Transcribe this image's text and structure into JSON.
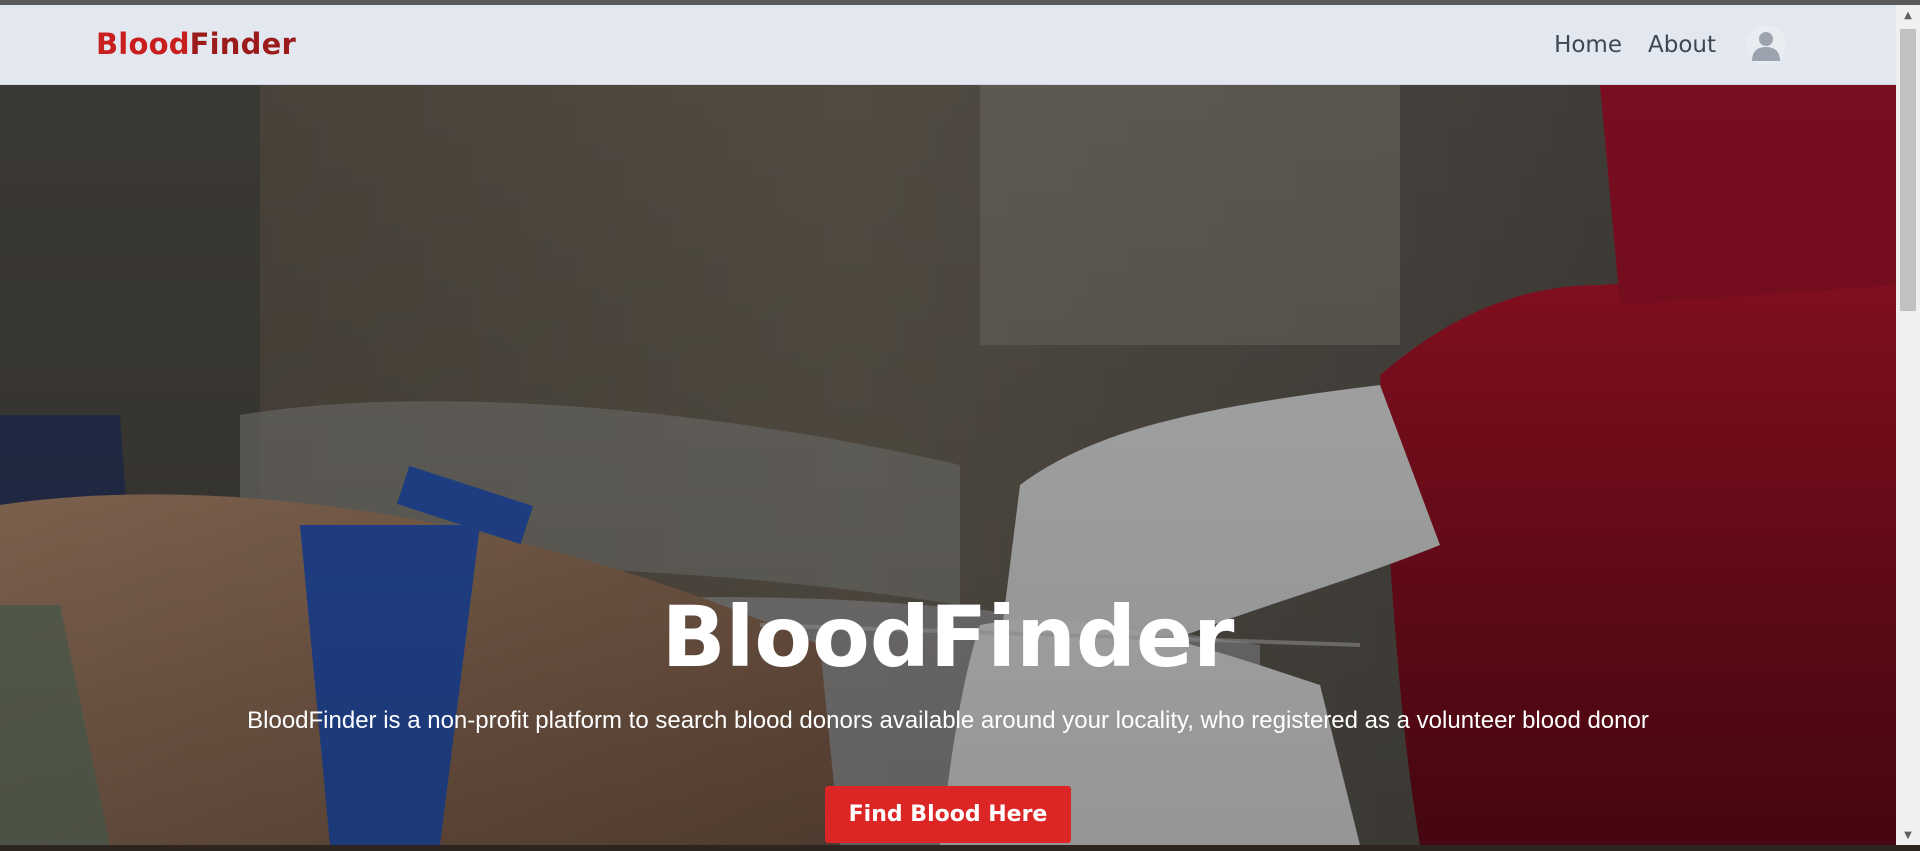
{
  "brand": {
    "part1": "Blood",
    "part2": "Finder"
  },
  "nav": {
    "home_label": "Home",
    "about_label": "About",
    "avatar_icon": "user-avatar-icon"
  },
  "hero": {
    "title": "BloodFinder",
    "description": "BloodFinder is a non-profit platform to search blood donors available around your locality, who registered as a volunteer blood donor",
    "cta_label": "Find Blood Here"
  },
  "colors": {
    "brand_red": "#c81e1e",
    "cta_red": "#dc2626",
    "navbar_bg": "#e3e8f0"
  }
}
